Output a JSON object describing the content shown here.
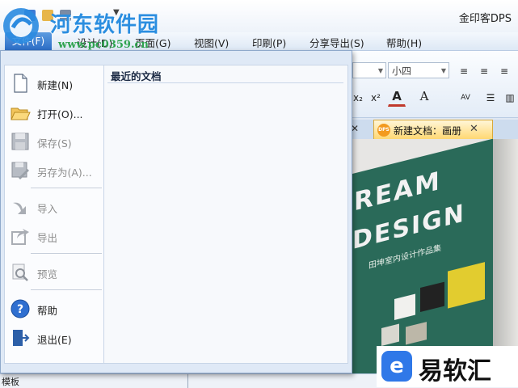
{
  "app_title": "金印客DPS",
  "menu": {
    "file": "文件(F)",
    "items": [
      "设计(D)",
      "页面(G)",
      "视图(V)",
      "印刷(P)",
      "分享导出(S)",
      "帮助(H)"
    ]
  },
  "ribbon": {
    "font_combo": "",
    "size_combo": "小四"
  },
  "doc_tab": {
    "label": "新建文档：画册",
    "badge": "DPS"
  },
  "file_menu": {
    "items": [
      {
        "label": "新建(N)",
        "enabled": true
      },
      {
        "label": "打开(O)...",
        "enabled": true
      },
      {
        "label": "保存(S)",
        "enabled": false
      },
      {
        "label": "另存为(A)...",
        "enabled": false
      },
      {
        "label": "导入",
        "enabled": false
      },
      {
        "label": "导出",
        "enabled": false
      },
      {
        "label": "预览",
        "enabled": false
      },
      {
        "label": "帮助",
        "enabled": true
      },
      {
        "label": "退出(E)",
        "enabled": true
      }
    ],
    "recent_title": "最近的文档"
  },
  "canvas": {
    "book_line1": "REAM",
    "book_line2": "DESIGN",
    "book_subtitle": "田坤室内设计作品集"
  },
  "bottom": {
    "panel_label": "模板"
  },
  "watermark": {
    "site_name": "河东软件园",
    "url": "www.pc0359.cn",
    "corner_brand": "易软汇"
  },
  "colors": {
    "accent": "#2d6ec6",
    "tab_active": "#ffd873",
    "book_green": "#2a6a59"
  }
}
